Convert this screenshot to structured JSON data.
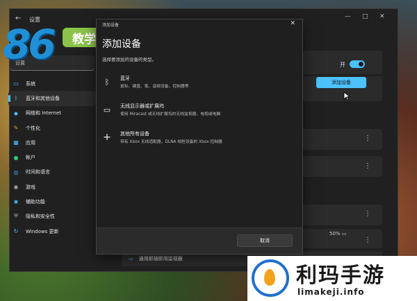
{
  "settings": {
    "title": "设置",
    "search_placeholder": "设置",
    "nav": [
      {
        "label": "系统",
        "icon": "system-icon",
        "color": "#4cc2ff"
      },
      {
        "label": "蓝牙和其他设备",
        "icon": "bluetooth-icon",
        "color": "#4cc2ff",
        "active": true
      },
      {
        "label": "网络和 Internet",
        "icon": "network-icon",
        "color": "#4cc2ff"
      },
      {
        "label": "个性化",
        "icon": "brush-icon",
        "color": "#f0a040"
      },
      {
        "label": "应用",
        "icon": "apps-icon",
        "color": "#4cc2ff"
      },
      {
        "label": "帐户",
        "icon": "account-icon",
        "color": "#35c07a"
      },
      {
        "label": "时间和语言",
        "icon": "globe-icon",
        "color": "#4cc2ff"
      },
      {
        "label": "游戏",
        "icon": "game-icon",
        "color": "#aaaaaa"
      },
      {
        "label": "辅助功能",
        "icon": "accessibility-icon",
        "color": "#4cc2ff"
      },
      {
        "label": "隐私和安全性",
        "icon": "shield-icon",
        "color": "#aaaaaa"
      },
      {
        "label": "Windows 更新",
        "icon": "update-icon",
        "color": "#4cc2ff"
      }
    ],
    "toggle_label": "开",
    "add_device_button": "添加设备",
    "battery_text": "50%",
    "monitor_label": "通用即插即用监视器"
  },
  "logo": {
    "number": "86",
    "badge": "教学"
  },
  "dialog": {
    "caption": "添加设备",
    "title": "添加设备",
    "subtitle": "选择要添加的设备的类型。",
    "options": [
      {
        "icon": "bluetooth-icon",
        "title": "蓝牙",
        "desc": "鼠标、键盘、笔、音频设备、控制器等"
      },
      {
        "icon": "monitor-icon",
        "title": "无线显示器或扩展坞",
        "desc": "使用 Miracast 或无线扩展坞的无线监视器、电视或电脑"
      },
      {
        "icon": "plus-icon",
        "title": "其他所有设备",
        "desc": "带有 Xbox 无线适配器、DLNA 相担设备的 Xbox 控制器"
      }
    ],
    "cancel_button": "取消"
  },
  "watermark": {
    "name": "利玛手游",
    "url": "limakeji.info"
  },
  "colors": {
    "accent": "#4cc2ff",
    "window_bg": "#202020",
    "dialog_bg": "#1f1f1f"
  }
}
